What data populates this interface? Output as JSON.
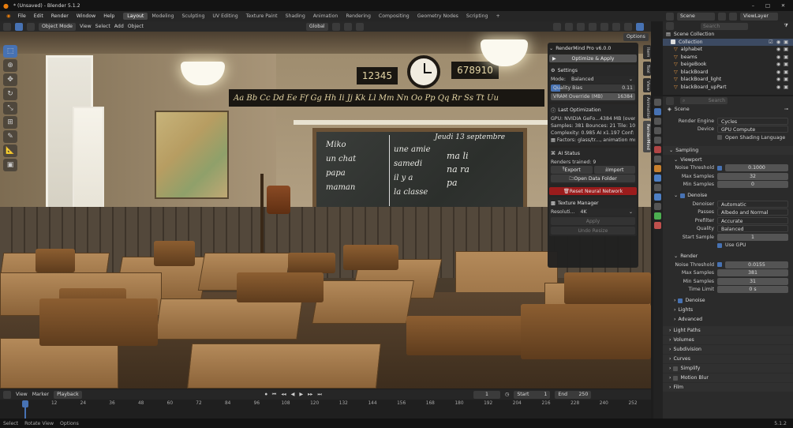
{
  "window": {
    "title": "* (Unsaved) - Blender 5.1.2",
    "controls": [
      "–",
      "□",
      "✕"
    ]
  },
  "menus": [
    "File",
    "Edit",
    "Render",
    "Window",
    "Help"
  ],
  "workspaces": [
    "Layout",
    "Modeling",
    "Sculpting",
    "UV Editing",
    "Texture Paint",
    "Shading",
    "Animation",
    "Rendering",
    "Compositing",
    "Geometry Nodes",
    "Scripting",
    "+"
  ],
  "viewport_header": {
    "mode": "Object Mode",
    "menus": [
      "View",
      "Select",
      "Add",
      "Object"
    ],
    "transform": "Global",
    "options": "Options"
  },
  "right_tabs": [
    "Item",
    "Tool",
    "View",
    "Animation",
    "RenderMind"
  ],
  "scene": {
    "counter": "12345",
    "counter2": "678910",
    "alphabet": "Aa Bb  Cc Dd Ee Ff Gg Hh Ii Jj Kk Ll Mm Nn Oo Pp Qq Rr Ss Tt Uu",
    "board_left": [
      "Miko",
      "un chat",
      "papa",
      "maman"
    ],
    "board_date": "Jeudi 13 septembre",
    "board_mid": [
      "une amie",
      "samedi",
      "il y a",
      "la classe"
    ],
    "board_right": [
      "ma",
      "li",
      "na",
      "ra",
      "pa"
    ]
  },
  "panel": {
    "title": "RenderMind Pro  v6.0.0",
    "optimize": "Optimize & Apply",
    "settings": {
      "header": "Settings",
      "mode_label": "Mode:",
      "mode_value": "Balanced",
      "quality_label": "Quality Bias",
      "quality_value": "0.11",
      "quality_fraction": 0.11,
      "vram_label": "VRAM Override (MB)",
      "vram_value": "16384"
    },
    "last": {
      "header": "Last Optimization",
      "lines": [
        "GPU: NVIDIA GeFo...4384 MB (override)",
        "Samples: 381  Bounces: 21  Tile: 102...",
        "Complexity: 0.985  AI x1.197  Conf: ...",
        "Factors: glass/tr..., animation mode"
      ]
    },
    "ai": {
      "header": "AI Status",
      "renders": "Renders trained: 9",
      "export": "Export",
      "import": "Import",
      "open": "Open Data Folder",
      "reset": "Reset Neural Network"
    },
    "texture": {
      "header": "Texture Manager",
      "res_label": "Resoluti...",
      "res_value": "4K",
      "apply": "Apply",
      "undo": "Undo Resize"
    }
  },
  "timeline": {
    "menus": [
      "View",
      "Marker",
      "Playback"
    ],
    "current": "1",
    "start_label": "Start",
    "start": "1",
    "end_label": "End",
    "end": "250",
    "ticks": [
      "1",
      "12",
      "24",
      "36",
      "48",
      "60",
      "72",
      "84",
      "96",
      "108",
      "120",
      "132",
      "144",
      "156",
      "168",
      "180",
      "192",
      "204",
      "216",
      "228",
      "240",
      "252"
    ]
  },
  "status": {
    "items": [
      "Select",
      "Rotate View",
      "Options"
    ],
    "version": "5.1.2"
  },
  "outliner": {
    "scene": "Scene",
    "viewlayer": "ViewLayer",
    "search_placeholder": "Search",
    "collection_root": "Scene Collection",
    "items": [
      "Collection",
      "alphabet",
      "beams",
      "beigeBook",
      "blackBoard",
      "blackBoard_light",
      "blackBoard_upPart"
    ]
  },
  "properties": {
    "search_placeholder": "Search",
    "scene_name": "Scene",
    "engine_label": "Render Engine",
    "engine_value": "Cycles",
    "device_label": "Device",
    "device_value": "GPU Compute",
    "osl": "Open Shading Language",
    "sampling": "Sampling",
    "viewport": "Viewport",
    "vp_noise_label": "Noise Threshold",
    "vp_noise": "0.1000",
    "vp_max_label": "Max Samples",
    "vp_max": "32",
    "vp_min_label": "Min Samples",
    "vp_min": "0",
    "denoise": "Denoise",
    "denoiser_label": "Denoiser",
    "denoiser": "Automatic",
    "passes_label": "Passes",
    "passes": "Albedo and Normal",
    "prefilter_label": "Prefilter",
    "prefilter": "Accurate",
    "quality_label": "Quality",
    "quality": "Balanced",
    "start_label": "Start Sample",
    "start": "1",
    "usegpu": "Use GPU",
    "render": "Render",
    "r_noise_label": "Noise Threshold",
    "r_noise": "0.0155",
    "r_max_label": "Max Samples",
    "r_max": "381",
    "r_min_label": "Min Samples",
    "r_min": "31",
    "r_time_label": "Time Limit",
    "r_time": "0 s",
    "denoise2": "Denoise",
    "lights": "Lights",
    "advanced": "Advanced",
    "sections": [
      "Light Paths",
      "Volumes",
      "Subdivision",
      "Curves",
      "Simplify",
      "Motion Blur",
      "Film"
    ]
  }
}
